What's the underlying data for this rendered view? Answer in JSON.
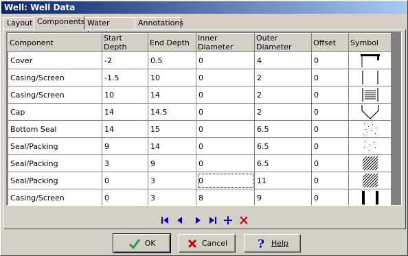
{
  "window": {
    "title": "Well: Well Data"
  },
  "tabs": [
    {
      "label": "Layout"
    },
    {
      "label": "Components"
    },
    {
      "label": "Water Levels"
    },
    {
      "label": "Annotations"
    }
  ],
  "table": {
    "columns": [
      "Component",
      "Start Depth",
      "End Depth",
      "Inner Diameter",
      "Outer Diameter",
      "Offset",
      "Symbol"
    ],
    "rows": [
      {
        "component": "Cover",
        "start": "-2",
        "end": "0.5",
        "inner": "0",
        "outer": "4",
        "offset": "0",
        "symbol": "cover-symbol"
      },
      {
        "component": "Casing/Screen",
        "start": "-1.5",
        "end": "10",
        "inner": "0",
        "outer": "2",
        "offset": "0",
        "symbol": "casing-symbol"
      },
      {
        "component": "Casing/Screen",
        "start": "10",
        "end": "14",
        "inner": "0",
        "outer": "2",
        "offset": "0",
        "symbol": "screen-symbol"
      },
      {
        "component": "Cap",
        "start": "14",
        "end": "14.5",
        "inner": "0",
        "outer": "2",
        "offset": "0",
        "symbol": "cap-symbol"
      },
      {
        "component": "Bottom Seal",
        "start": "14",
        "end": "15",
        "inner": "0",
        "outer": "6.5",
        "offset": "0",
        "symbol": "dots-symbol"
      },
      {
        "component": "Seal/Packing",
        "start": "9",
        "end": "14",
        "inner": "0",
        "outer": "6.5",
        "offset": "0",
        "symbol": "dots-symbol"
      },
      {
        "component": "Seal/Packing",
        "start": "3",
        "end": "9",
        "inner": "0",
        "outer": "6.5",
        "offset": "0",
        "symbol": "hatch-symbol"
      },
      {
        "component": "Seal/Packing",
        "start": "0",
        "end": "3",
        "inner": "0",
        "outer": "11",
        "offset": "0",
        "symbol": "hatch-symbol"
      },
      {
        "component": "Casing/Screen",
        "start": "0",
        "end": "3",
        "inner": "8",
        "outer": "9",
        "offset": "0",
        "symbol": "thick-casing-symbol"
      }
    ]
  },
  "nav": [
    "first-icon",
    "prev-icon",
    "next-icon",
    "last-icon",
    "add-icon",
    "delete-icon"
  ],
  "buttons": {
    "ok": "OK",
    "cancel": "Cancel",
    "help": "Help"
  },
  "colors": {
    "titlebar_start": "#0a246a",
    "titlebar_end": "#a6caf0",
    "nav_blue": "#0000c0",
    "delete_red": "#c00000",
    "ok_green": "#2e9a2e"
  }
}
